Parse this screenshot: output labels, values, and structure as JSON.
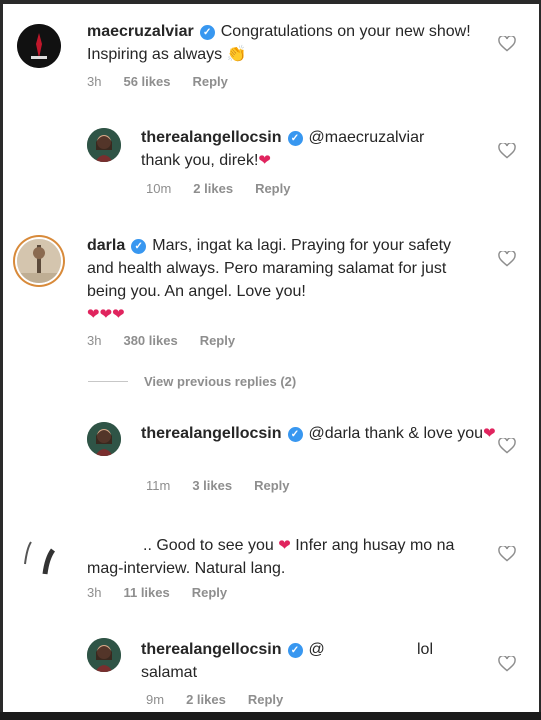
{
  "colors": {
    "heart": "#e0245e",
    "verified": "#3897f0",
    "meta": "#8e8e8e"
  },
  "comments": [
    {
      "user": "maecruzalviar",
      "text": "Congratulations on your new show! Inspiring as always",
      "time": "3h",
      "likes": "56 likes",
      "reply": "Reply"
    },
    {
      "user": "therealangellocsin",
      "mention": "@maecruzalviar",
      "text": "thank you, direk!",
      "time": "10m",
      "likes": "2 likes",
      "reply": "Reply"
    },
    {
      "user": "darla",
      "text": "Mars, ingat ka lagi. Praying for your safety and health always. Pero maraming salamat for just being you. An angel. Love you!",
      "time": "3h",
      "likes": "380 likes",
      "reply": "Reply"
    },
    {
      "user": "therealangellocsin",
      "mention": "@darla",
      "text": "thank & love you",
      "time": "11m",
      "likes": "3 likes",
      "reply": "Reply"
    },
    {
      "text_a": ".. Good to see you",
      "text_b": "Infer ang husay mo na mag-interview. Natural lang.",
      "time": "3h",
      "likes": "11 likes",
      "reply": "Reply"
    },
    {
      "user": "therealangellocsin",
      "mention": "@",
      "text_end": "lol",
      "text": "salamat",
      "time": "9m",
      "likes": "2 likes",
      "reply": "Reply"
    }
  ],
  "view_previous": "View previous replies (2)"
}
